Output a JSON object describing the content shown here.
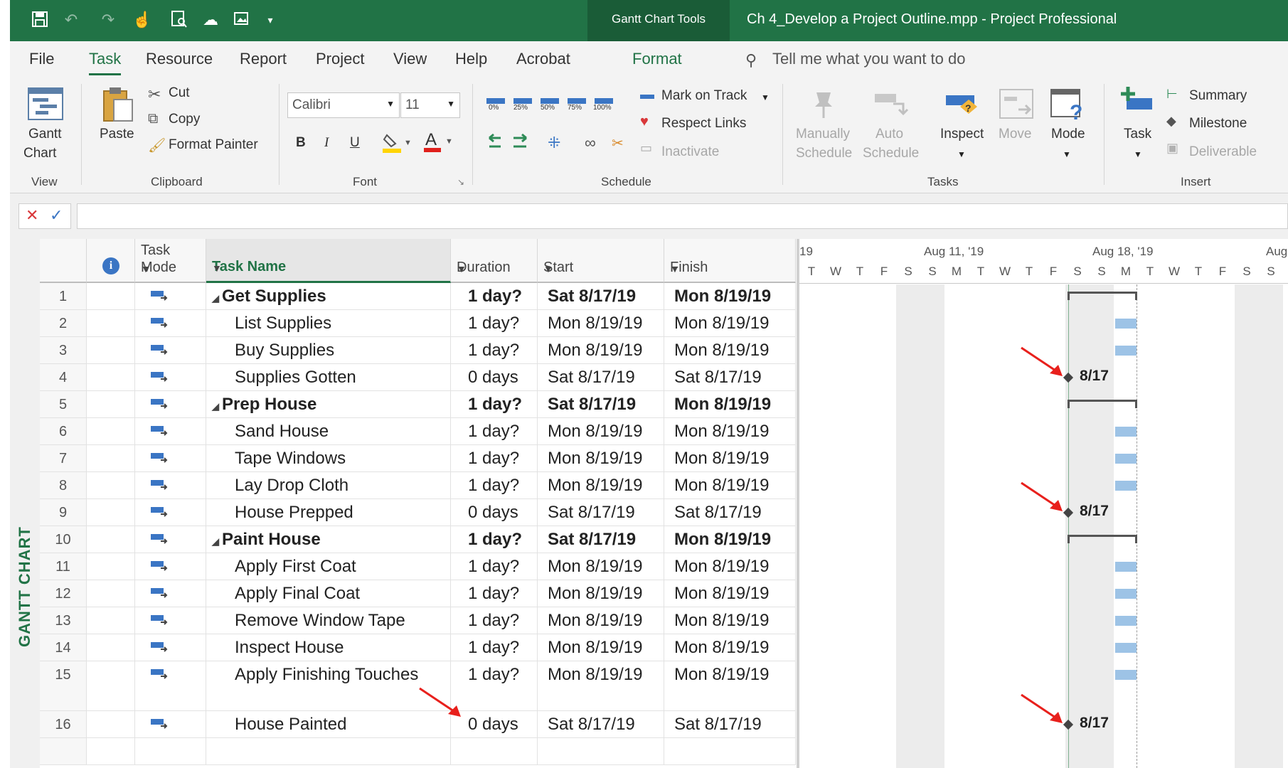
{
  "titlebar": {
    "context_tab": "Gantt Chart Tools",
    "document_title": "Ch 4_Develop a Project Outline.mpp  -  Project Professional"
  },
  "ribbon": {
    "tabs": [
      "File",
      "Task",
      "Resource",
      "Report",
      "Project",
      "View",
      "Help",
      "Acrobat",
      "Format"
    ],
    "active_tab": "Task",
    "tell_me": "Tell me what you want to do",
    "view": {
      "gantt_chart": "Gantt",
      "gantt_chart2": "Chart",
      "group": "View"
    },
    "clipboard": {
      "paste": "Paste",
      "cut": "Cut",
      "copy": "Copy",
      "format_painter": "Format Painter",
      "group": "Clipboard"
    },
    "font": {
      "family": "Calibri",
      "size": "11",
      "bold": "B",
      "italic": "I",
      "underline": "U",
      "group": "Font"
    },
    "schedule": {
      "percents": [
        "0%",
        "25%",
        "50%",
        "75%",
        "100%"
      ],
      "mark_on_track": "Mark on Track",
      "respect_links": "Respect Links",
      "inactivate": "Inactivate",
      "group": "Schedule"
    },
    "tasks": {
      "manually": "Manually",
      "manually2": "Schedule",
      "auto": "Auto",
      "auto2": "Schedule",
      "inspect": "Inspect",
      "move": "Move",
      "mode": "Mode",
      "group": "Tasks"
    },
    "insert": {
      "task": "Task",
      "summary": "Summary",
      "milestone": "Milestone",
      "deliverable": "Deliverable",
      "group": "Insert"
    }
  },
  "side_label": "GANTT CHART",
  "table": {
    "headers": {
      "info": "i",
      "mode1": "Task",
      "mode2": "Mode",
      "name": "Task Name",
      "duration": "Duration",
      "start": "Start",
      "finish": "Finish"
    },
    "rows": [
      {
        "id": "1",
        "name": "Get Supplies",
        "duration": "1 day?",
        "start": "Sat 8/17/19",
        "finish": "Mon 8/19/19"
      },
      {
        "id": "2",
        "name": "List Supplies",
        "duration": "1 day?",
        "start": "Mon 8/19/19",
        "finish": "Mon 8/19/19"
      },
      {
        "id": "3",
        "name": "Buy Supplies",
        "duration": "1 day?",
        "start": "Mon 8/19/19",
        "finish": "Mon 8/19/19"
      },
      {
        "id": "4",
        "name": "Supplies Gotten",
        "duration": "0 days",
        "start": "Sat 8/17/19",
        "finish": "Sat 8/17/19"
      },
      {
        "id": "5",
        "name": "Prep House",
        "duration": "1 day?",
        "start": "Sat 8/17/19",
        "finish": "Mon 8/19/19"
      },
      {
        "id": "6",
        "name": "Sand House",
        "duration": "1 day?",
        "start": "Mon 8/19/19",
        "finish": "Mon 8/19/19"
      },
      {
        "id": "7",
        "name": "Tape Windows",
        "duration": "1 day?",
        "start": "Mon 8/19/19",
        "finish": "Mon 8/19/19"
      },
      {
        "id": "8",
        "name": "Lay Drop Cloth",
        "duration": "1 day?",
        "start": "Mon 8/19/19",
        "finish": "Mon 8/19/19"
      },
      {
        "id": "9",
        "name": "House Prepped",
        "duration": "0 days",
        "start": "Sat 8/17/19",
        "finish": "Sat 8/17/19"
      },
      {
        "id": "10",
        "name": "Paint House",
        "duration": "1 day?",
        "start": "Sat 8/17/19",
        "finish": "Mon 8/19/19"
      },
      {
        "id": "11",
        "name": "Apply First Coat",
        "duration": "1 day?",
        "start": "Mon 8/19/19",
        "finish": "Mon 8/19/19"
      },
      {
        "id": "12",
        "name": "Apply Final Coat",
        "duration": "1 day?",
        "start": "Mon 8/19/19",
        "finish": "Mon 8/19/19"
      },
      {
        "id": "13",
        "name": "Remove Window Tape",
        "duration": "1 day?",
        "start": "Mon 8/19/19",
        "finish": "Mon 8/19/19"
      },
      {
        "id": "14",
        "name": "Inspect House",
        "duration": "1 day?",
        "start": "Mon 8/19/19",
        "finish": "Mon 8/19/19"
      },
      {
        "id": "15",
        "name": "Apply Finishing Touches",
        "duration": "1 day?",
        "start": "Mon 8/19/19",
        "finish": "Mon 8/19/19"
      },
      {
        "id": "16",
        "name": "House Painted",
        "duration": "0 days",
        "start": "Sat 8/17/19",
        "finish": "Sat 8/17/19"
      }
    ]
  },
  "gantt": {
    "weeks": [
      "19",
      "Aug 11, '19",
      "Aug 18, '19",
      "Aug"
    ],
    "days": [
      "T",
      "W",
      "T",
      "F",
      "S",
      "S",
      "M",
      "T",
      "W",
      "T",
      "F",
      "S",
      "S",
      "M",
      "T",
      "W",
      "T",
      "F",
      "S",
      "S"
    ],
    "milestone_label": "8/17"
  },
  "colors": {
    "accent": "#217346",
    "bar": "#9dc3e6",
    "arrow": "#e8201c"
  }
}
